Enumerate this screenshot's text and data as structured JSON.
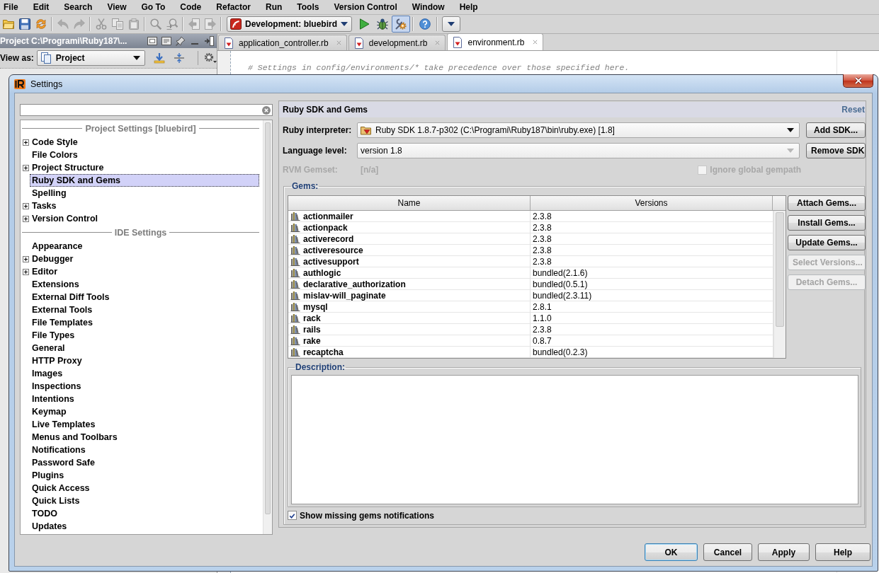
{
  "menu_bar": [
    "File",
    "Edit",
    "Search",
    "View",
    "Go To",
    "Code",
    "Refactor",
    "Run",
    "Tools",
    "Version Control",
    "Window",
    "Help"
  ],
  "toolbar": {
    "left_groups": [
      {
        "buttons": [
          {
            "kind": "open",
            "disabled": false
          },
          {
            "kind": "save",
            "disabled": false
          },
          {
            "kind": "sync",
            "disabled": false
          }
        ]
      },
      {
        "buttons": [
          {
            "kind": "undo",
            "disabled": true
          },
          {
            "kind": "redo",
            "disabled": true
          }
        ]
      },
      {
        "buttons": [
          {
            "kind": "cut",
            "disabled": true
          },
          {
            "kind": "copy",
            "disabled": true
          },
          {
            "kind": "paste",
            "disabled": true
          }
        ]
      },
      {
        "buttons": [
          {
            "kind": "find",
            "disabled": true
          },
          {
            "kind": "replace",
            "disabled": true
          }
        ]
      },
      {
        "buttons": [
          {
            "kind": "back",
            "disabled": true
          },
          {
            "kind": "forward",
            "disabled": true
          }
        ]
      }
    ],
    "run_configuration": "Development: bluebird",
    "right_groups": [
      {
        "buttons": [
          {
            "kind": "run",
            "pressed": false
          },
          {
            "kind": "debug",
            "pressed": false
          },
          {
            "kind": "settings",
            "pressed": true
          }
        ]
      },
      {
        "buttons": [
          {
            "kind": "help",
            "pressed": false
          }
        ]
      },
      {
        "buttons": [
          {
            "kind": "more",
            "pressed": false
          }
        ]
      }
    ]
  },
  "project_panel": {
    "title": "Project C:\\Programi\\Ruby187\\...",
    "view_as_label": "View as:",
    "view_as_value": "Project"
  },
  "editor": {
    "tabs": [
      {
        "label": "application_controller.rb",
        "selected": false
      },
      {
        "label": "development.rb",
        "selected": false
      },
      {
        "label": "environment.rb",
        "selected": true
      }
    ],
    "code_lines": [
      "# Settings in config/environments/* take precedence over those specified here."
    ]
  },
  "settings_dialog": {
    "title": "Settings",
    "tree": {
      "sections": [
        {
          "title": "Project Settings [bluebird]",
          "items": [
            {
              "label": "Code Style",
              "expandable": true,
              "selected": false
            },
            {
              "label": "File Colors",
              "expandable": false,
              "selected": false
            },
            {
              "label": "Project Structure",
              "expandable": true,
              "selected": false
            },
            {
              "label": "Ruby SDK and Gems",
              "expandable": false,
              "selected": true
            },
            {
              "label": "Spelling",
              "expandable": false,
              "selected": false
            },
            {
              "label": "Tasks",
              "expandable": true,
              "selected": false
            },
            {
              "label": "Version Control",
              "expandable": true,
              "selected": false
            }
          ]
        },
        {
          "title": "IDE Settings",
          "items": [
            {
              "label": "Appearance",
              "expandable": false,
              "selected": false
            },
            {
              "label": "Debugger",
              "expandable": true,
              "selected": false
            },
            {
              "label": "Editor",
              "expandable": true,
              "selected": false
            },
            {
              "label": "Extensions",
              "expandable": false,
              "selected": false
            },
            {
              "label": "External Diff Tools",
              "expandable": false,
              "selected": false
            },
            {
              "label": "External Tools",
              "expandable": false,
              "selected": false
            },
            {
              "label": "File Templates",
              "expandable": false,
              "selected": false
            },
            {
              "label": "File Types",
              "expandable": false,
              "selected": false
            },
            {
              "label": "General",
              "expandable": false,
              "selected": false
            },
            {
              "label": "HTTP Proxy",
              "expandable": false,
              "selected": false
            },
            {
              "label": "Images",
              "expandable": false,
              "selected": false
            },
            {
              "label": "Inspections",
              "expandable": false,
              "selected": false
            },
            {
              "label": "Intentions",
              "expandable": false,
              "selected": false
            },
            {
              "label": "Keymap",
              "expandable": false,
              "selected": false
            },
            {
              "label": "Live Templates",
              "expandable": false,
              "selected": false
            },
            {
              "label": "Menus and Toolbars",
              "expandable": false,
              "selected": false
            },
            {
              "label": "Notifications",
              "expandable": false,
              "selected": false
            },
            {
              "label": "Password Safe",
              "expandable": false,
              "selected": false
            },
            {
              "label": "Plugins",
              "expandable": false,
              "selected": false
            },
            {
              "label": "Quick Access",
              "expandable": false,
              "selected": false
            },
            {
              "label": "Quick Lists",
              "expandable": false,
              "selected": false
            },
            {
              "label": "TODO",
              "expandable": false,
              "selected": false
            },
            {
              "label": "Updates",
              "expandable": false,
              "selected": false
            }
          ]
        }
      ]
    },
    "page": {
      "title": "Ruby SDK and Gems",
      "reset_link": "Reset",
      "interpreter": {
        "label": "Ruby interpreter:",
        "value": "Ruby SDK 1.8.7-p302 (C:\\Programi\\Ruby187\\bin\\ruby.exe) [1.8]",
        "disabled": false,
        "button": "Add SDK..."
      },
      "language_level": {
        "label": "Language level:",
        "value": "version 1.8",
        "disabled": true,
        "button": "Remove SDK"
      },
      "rvm_gemset": {
        "label": "RVM Gemset:",
        "value": "[n/a]",
        "disabled": true
      },
      "ignore_global_gempath": {
        "label": "Ignore global gempath",
        "checked": false,
        "disabled": true
      },
      "gems": {
        "title": "Gems:",
        "columns": [
          "Name",
          "Versions"
        ],
        "rows": [
          {
            "name": "actionmailer",
            "version": "2.3.8"
          },
          {
            "name": "actionpack",
            "version": "2.3.8"
          },
          {
            "name": "activerecord",
            "version": "2.3.8"
          },
          {
            "name": "activeresource",
            "version": "2.3.8"
          },
          {
            "name": "activesupport",
            "version": "2.3.8"
          },
          {
            "name": "authlogic",
            "version": "bundled(2.1.6)"
          },
          {
            "name": "declarative_authorization",
            "version": "bundled(0.5.1)"
          },
          {
            "name": "mislav-will_paginate",
            "version": "bundled(2.3.11)"
          },
          {
            "name": "mysql",
            "version": "2.8.1"
          },
          {
            "name": "rack",
            "version": "1.1.0"
          },
          {
            "name": "rails",
            "version": "2.3.8"
          },
          {
            "name": "rake",
            "version": "0.8.7"
          },
          {
            "name": "recaptcha",
            "version": "bundled(0.2.3)"
          }
        ],
        "buttons": [
          {
            "label": "Attach Gems...",
            "disabled": false
          },
          {
            "label": "Install Gems...",
            "disabled": false
          },
          {
            "label": "Update Gems...",
            "disabled": false
          },
          {
            "label": "Select Versions...",
            "disabled": true
          },
          {
            "label": "Detach Gems...",
            "disabled": true
          }
        ]
      },
      "description": {
        "title": "Description:"
      },
      "show_missing_gems_notifications": {
        "label": "Show missing gems notifications",
        "checked": true
      }
    },
    "buttons": [
      {
        "label": "OK",
        "default": true
      },
      {
        "label": "Cancel",
        "default": false
      },
      {
        "label": "Apply",
        "default": false
      },
      {
        "label": "Help",
        "default": false
      }
    ]
  }
}
